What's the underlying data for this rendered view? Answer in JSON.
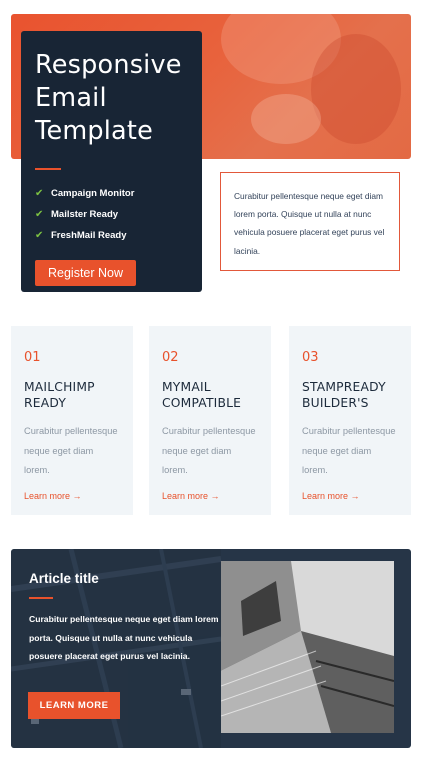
{
  "hero": {
    "title": "Responsive\nEmail\nTemplate",
    "features": [
      "Campaign Monitor",
      "Mailster Ready",
      "FreshMail Ready"
    ],
    "check_icon": "check-icon",
    "button_label": "Register Now",
    "quote": "Curabitur pellentesque neque eget diam lorem porta. Quisque ut nulla at nunc vehicula posuere placerat eget purus vel lacinia."
  },
  "features": [
    {
      "number": "01",
      "title": "MAILCHIMP\nREADY",
      "desc": "Curabitur pellentesque neque eget diam lorem.",
      "link": "Learn more →"
    },
    {
      "number": "02",
      "title": "MYMAIL\nCOMPATIBLE",
      "desc": "Curabitur pellentesque neque eget diam lorem.",
      "link": "Learn more →"
    },
    {
      "number": "03",
      "title": "STAMPREADY\nBUILDER'S",
      "desc": "Curabitur pellentesque neque eget diam lorem.",
      "link": "Learn more →"
    }
  ],
  "article": {
    "title": "Article title",
    "body": "Curabitur pellentesque neque eget diam lorem porta. Quisque ut nulla at nunc vehicula posuere placerat eget purus vel lacinia.",
    "button_label": "LEARN MORE"
  },
  "colors": {
    "accent": "#e8522c",
    "navy": "#182535",
    "check": "#7cc242",
    "light_panel": "#f1f5f8"
  }
}
